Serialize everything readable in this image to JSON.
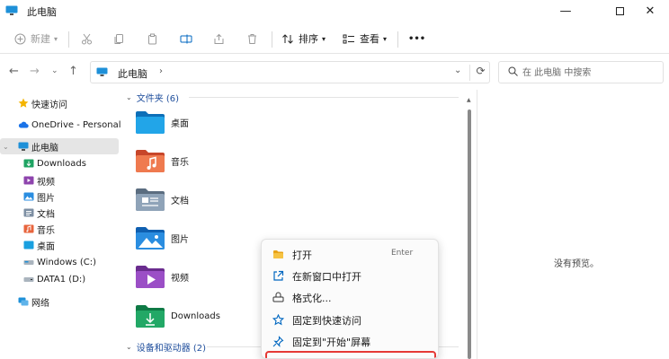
{
  "window": {
    "title": "此电脑"
  },
  "toolbar": {
    "new_label": "新建",
    "sort_label": "排序",
    "view_label": "查看",
    "more_label": "•••"
  },
  "address": {
    "crumb": "此电脑",
    "arrow": "›"
  },
  "search": {
    "placeholder": "在 此电脑 中搜索"
  },
  "sidebar": {
    "items": [
      {
        "label": "快速访问"
      },
      {
        "label": "OneDrive - Personal"
      },
      {
        "label": "此电脑"
      },
      {
        "label": "Downloads"
      },
      {
        "label": "视频"
      },
      {
        "label": "图片"
      },
      {
        "label": "文档"
      },
      {
        "label": "音乐"
      },
      {
        "label": "桌面"
      },
      {
        "label": "Windows (C:)"
      },
      {
        "label": "DATA1 (D:)"
      },
      {
        "label": "网络"
      }
    ]
  },
  "content": {
    "folders_header": "文件夹 (6)",
    "devices_header": "设备和驱动器 (2)",
    "folders": [
      {
        "name": "桌面"
      },
      {
        "name": "音乐"
      },
      {
        "name": "文档"
      },
      {
        "name": "图片"
      },
      {
        "name": "视频"
      },
      {
        "name": "Downloads"
      }
    ]
  },
  "preview": {
    "message": "没有预览。"
  },
  "context_menu": {
    "items": [
      {
        "label": "打开",
        "accel": "Enter"
      },
      {
        "label": "在新窗口中打开",
        "accel": ""
      },
      {
        "label": "格式化...",
        "accel": ""
      },
      {
        "label": "固定到快速访问",
        "accel": ""
      },
      {
        "label": "固定到\"开始\"屏幕",
        "accel": ""
      }
    ]
  },
  "colors": {
    "accent": "#0067c0",
    "selection": "#e5e5e5",
    "highlight_border": "#e53935"
  }
}
